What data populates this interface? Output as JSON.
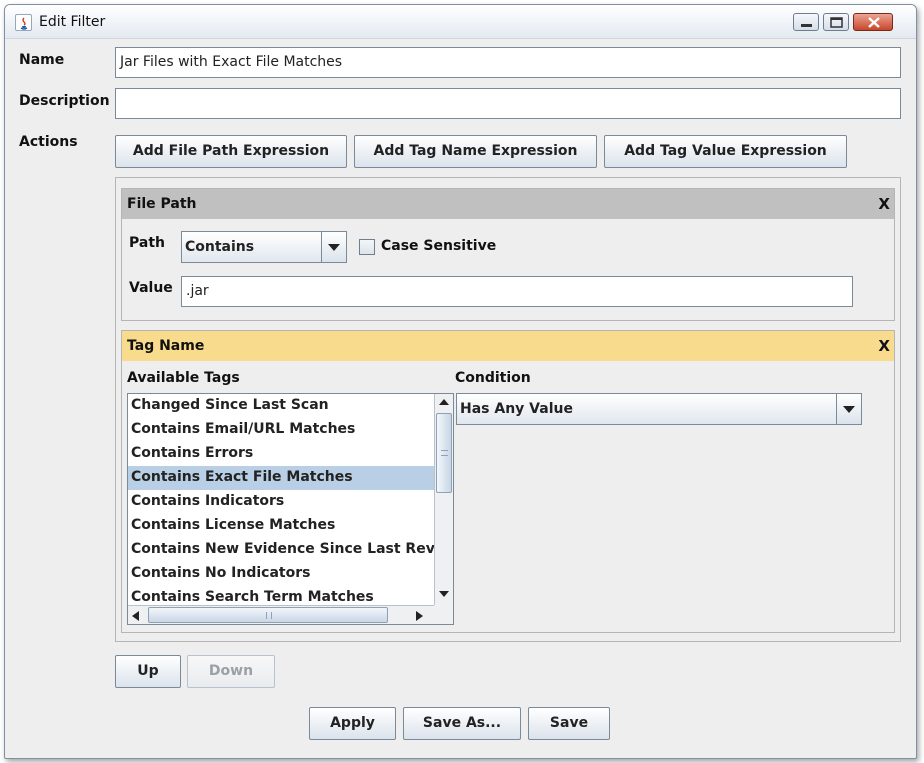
{
  "window": {
    "title": "Edit Filter"
  },
  "form": {
    "name_label": "Name",
    "name_value": "Jar Files with Exact File Matches",
    "description_label": "Description",
    "description_value": "",
    "actions_label": "Actions"
  },
  "actions": {
    "add_file_path": "Add File Path Expression",
    "add_tag_name": "Add Tag Name Expression",
    "add_tag_value": "Add Tag Value Expression"
  },
  "file_path_panel": {
    "title": "File Path",
    "close": "X",
    "path_label": "Path",
    "path_selected": "Contains",
    "case_sensitive_label": "Case Sensitive",
    "case_sensitive_checked": false,
    "value_label": "Value",
    "value": ".jar"
  },
  "tag_name_panel": {
    "title": "Tag Name",
    "close": "X",
    "available_tags_label": "Available Tags",
    "available_tags": [
      "Changed Since Last Scan",
      "Contains Email/URL Matches",
      "Contains Errors",
      "Contains Exact File Matches",
      "Contains Indicators",
      "Contains License Matches",
      "Contains New Evidence Since Last Review",
      "Contains No Indicators",
      "Contains Search Term Matches"
    ],
    "selected_tag_index": 3,
    "condition_label": "Condition",
    "condition_selected": "Has Any Value"
  },
  "order": {
    "up": "Up",
    "down": "Down"
  },
  "footer": {
    "apply": "Apply",
    "save_as": "Save As...",
    "save": "Save"
  },
  "colors": {
    "file_path_header": "#c0c0c0",
    "tag_name_header": "#f8db8c",
    "selected_row": "#b8cfe5"
  }
}
